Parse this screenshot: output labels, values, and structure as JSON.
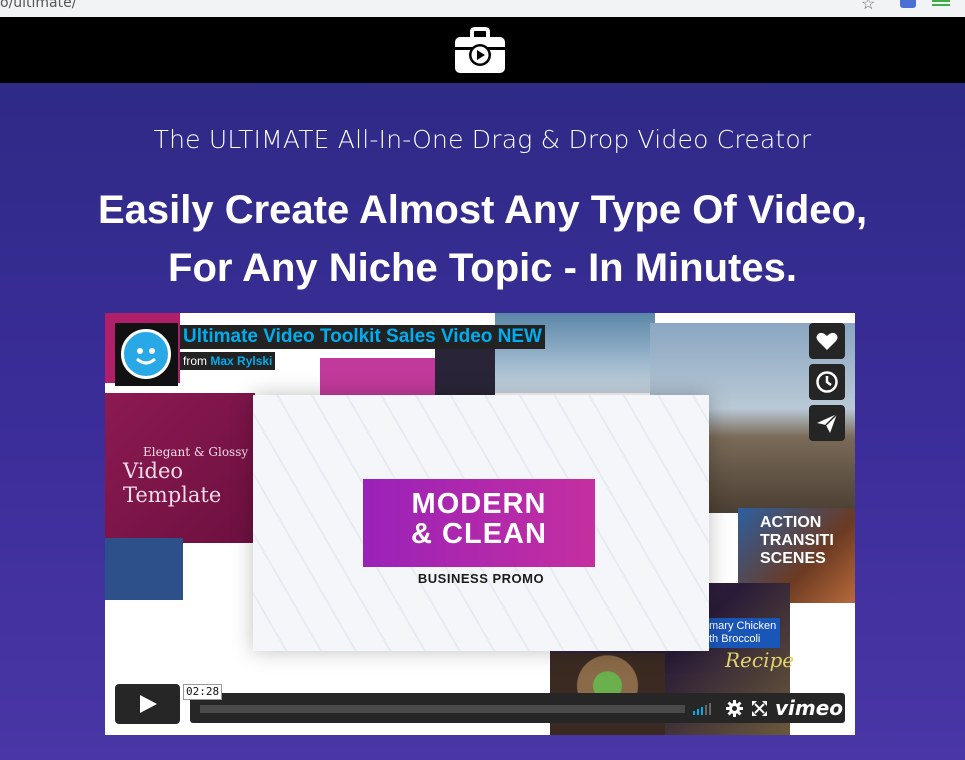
{
  "browser": {
    "url": "o/ultimate/"
  },
  "header": {
    "logo_icon": "video-briefcase-icon"
  },
  "hero": {
    "subtitle": "The ULTIMATE All-In-One Drag & Drop Video Creator",
    "headline_line1": "Easily Create Almost Any Type Of Video,",
    "headline_line2": "For Any Niche Topic - In Minutes."
  },
  "video": {
    "title": "Ultimate Video Toolkit Sales Video NEW",
    "byline_prefix": "from",
    "byline_author": "Max Rylski",
    "thumbnail": {
      "main_line1": "MODERN",
      "main_line2": "& CLEAN",
      "main_sub": "BUSINESS PROMO",
      "elegant_small": "Elegant & Glossy",
      "elegant_big": "Video Template",
      "action_line1": "ACTION",
      "action_line2": "TRANSITI",
      "action_line3": "SCENES",
      "recipe_tag1": "mary Chicken",
      "recipe_tag2": "th Broccoli",
      "recipe_script": "Recipe"
    },
    "controls": {
      "time": "02:28",
      "brand": "vimeo"
    },
    "side_buttons": [
      "heart-icon",
      "clock-icon",
      "send-icon"
    ]
  },
  "colors": {
    "hero_bg": "#3b2d99",
    "topbar": "#000000",
    "title_blue": "#00adef",
    "promo_magenta": "#b32aa8"
  }
}
